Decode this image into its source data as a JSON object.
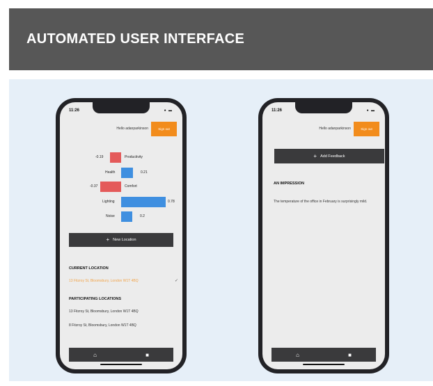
{
  "header": {
    "title": "AUTOMATED USER INTERFACE"
  },
  "phone1": {
    "time": "11:26",
    "status": "● ▬",
    "hello": "Hello adanparkinson",
    "logout": "Sign out",
    "metrics": [
      {
        "label": "Productivity",
        "value": "-0.19",
        "num": -0.19
      },
      {
        "label": "Health",
        "value": "0.21",
        "num": 0.21
      },
      {
        "label": "Comfort",
        "value": "-0.37",
        "num": -0.37
      },
      {
        "label": "Lighting",
        "value": "0.78",
        "num": 0.78
      },
      {
        "label": "Noise",
        "value": "0.2",
        "num": 0.2
      }
    ],
    "new_location_label": "New Location",
    "current_heading": "CURRENT LOCATION",
    "current_location": "13 Fitzroy St, Bloomsbury, London W1T 4BQ",
    "participating_heading": "PARTICIPATING LOCATIONS",
    "locations": [
      "13 Fitzroy St, Bloomsbury, London W1T 4BQ",
      "8 Fitzroy St, Bloomsbury, London W1T 4BQ"
    ],
    "tabs": {
      "home": "⌂",
      "feedback": "■"
    }
  },
  "phone2": {
    "time": "11:26",
    "status": "● ▬",
    "hello": "Hello adanparkinson",
    "logout": "Sign out",
    "add_feedback_label": "Add Feedback",
    "impression_heading": "AN IMPRESSION",
    "impression_text": "The temperature of the office in February is surprisingly mild.",
    "tabs": {
      "home": "⌂",
      "feedback": "■"
    }
  },
  "colors": {
    "header_bg": "#575757",
    "panel_bg": "#e6eff8",
    "accent_orange": "#f28c1c",
    "negative_bar": "#e45a5a",
    "positive_bar": "#3f8fe0",
    "dark_button": "#3a3a3c"
  }
}
